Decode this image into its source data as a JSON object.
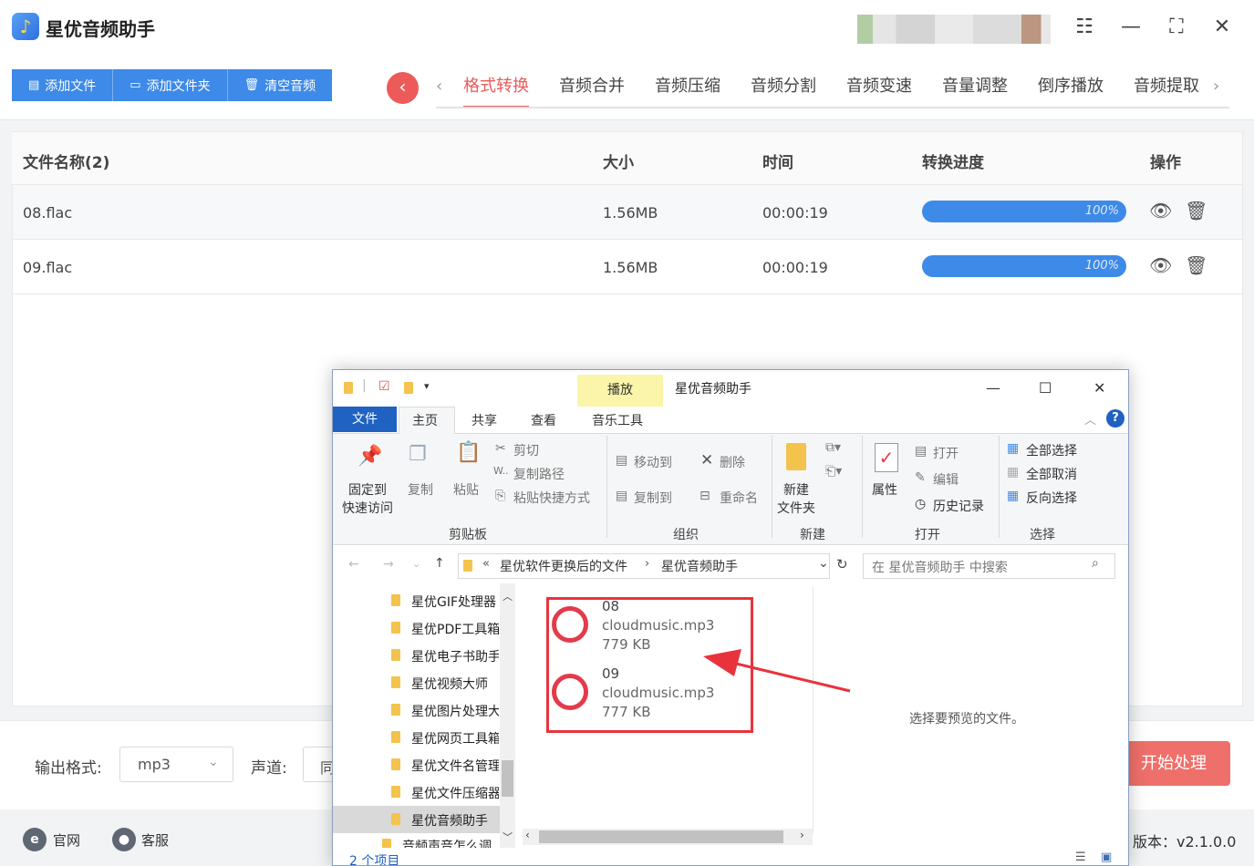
{
  "app": {
    "title": "星优音频助手",
    "version": "版本：v2.1.0.0"
  },
  "toolbar": {
    "add_file": "添加文件",
    "add_folder": "添加文件夹",
    "clear": "清空音频"
  },
  "tabs": [
    "格式转换",
    "音频合并",
    "音频压缩",
    "音频分割",
    "音频变速",
    "音量调整",
    "倒序播放",
    "音频提取"
  ],
  "table": {
    "headers": [
      "文件名称(2)",
      "大小",
      "时间",
      "转换进度",
      "操作"
    ],
    "rows": [
      {
        "name": "08.flac",
        "size": "1.56MB",
        "time": "00:00:19",
        "progress": "100%"
      },
      {
        "name": "09.flac",
        "size": "1.56MB",
        "time": "00:00:19",
        "progress": "100%"
      }
    ]
  },
  "bottom": {
    "format_label": "输出格式:",
    "format_value": "mp3",
    "channel_label": "声道:",
    "channel_value": "同",
    "start": "开始处理"
  },
  "footer": {
    "website": "官网",
    "support": "客服"
  },
  "explorer": {
    "title": "星优音频助手",
    "context_tab": "播放",
    "tabs": {
      "file": "文件",
      "home": "主页",
      "share": "共享",
      "view": "查看",
      "music_tools": "音乐工具"
    },
    "ribbon": {
      "pin": "固定到",
      "pin2": "快速访问",
      "copy": "复制",
      "paste": "粘贴",
      "cut": "剪切",
      "copy_path": "复制路径",
      "paste_shortcut": "粘贴快捷方式",
      "move_to": "移动到",
      "copy_to": "复制到",
      "delete": "删除",
      "rename": "重命名",
      "new_folder": "新建",
      "new_folder2": "文件夹",
      "properties": "属性",
      "open": "打开",
      "edit": "编辑",
      "history": "历史记录",
      "select_all": "全部选择",
      "select_none": "全部取消",
      "invert": "反向选择",
      "groups": {
        "clipboard": "剪贴板",
        "organize": "组织",
        "new": "新建",
        "open": "打开",
        "select": "选择"
      }
    },
    "address": {
      "prefix": "«",
      "part1": "星优软件更换后的文件",
      "part2": "星优音频助手",
      "search_placeholder": "在 星优音频助手 中搜索"
    },
    "nav": [
      "星优GIF处理器",
      "星优PDF工具箱",
      "星优电子书助手",
      "星优视频大师",
      "星优图片处理大师",
      "星优网页工具箱",
      "星优文件名管理",
      "星优文件压缩器",
      "星优音频助手",
      "音频声音怎么调"
    ],
    "files": [
      {
        "line1": "08",
        "line2": "cloudmusic.mp3",
        "size": "779 KB"
      },
      {
        "line1": "09",
        "line2": "cloudmusic.mp3",
        "size": "777 KB"
      }
    ],
    "preview": "选择要预览的文件。",
    "status": "2 个项目"
  },
  "colors": {
    "accent": "#3d8ae8",
    "tab_active": "#ec5a5a",
    "start_button": "#ef6f6a",
    "highlight": "#e8333d"
  }
}
